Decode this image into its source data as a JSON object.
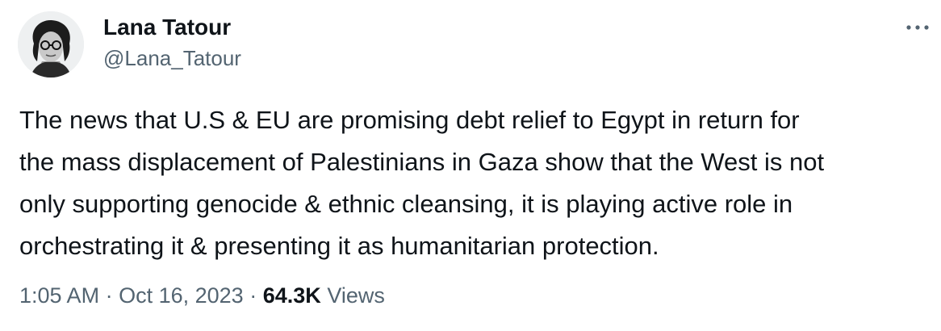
{
  "author": {
    "name": "Lana Tatour",
    "handle": "@Lana_Tatour"
  },
  "tweet": {
    "lines": [
      "The news that U.S & EU are promising debt relief to Egypt in return for",
      "the mass displacement of Palestinians in Gaza show that the West is not",
      "only supporting genocide & ethnic cleansing, it is playing active role in",
      "orchestrating it & presenting it as humanitarian protection."
    ]
  },
  "meta": {
    "time": "1:05 AM",
    "separator": "·",
    "date": "Oct 16, 2023",
    "views_count": "64.3K",
    "views_label": "Views"
  },
  "icons": {
    "more": "more-options-icon",
    "avatar": "profile-photo"
  },
  "colors": {
    "text_primary": "#0f1419",
    "text_secondary": "#536471",
    "background": "#ffffff"
  }
}
